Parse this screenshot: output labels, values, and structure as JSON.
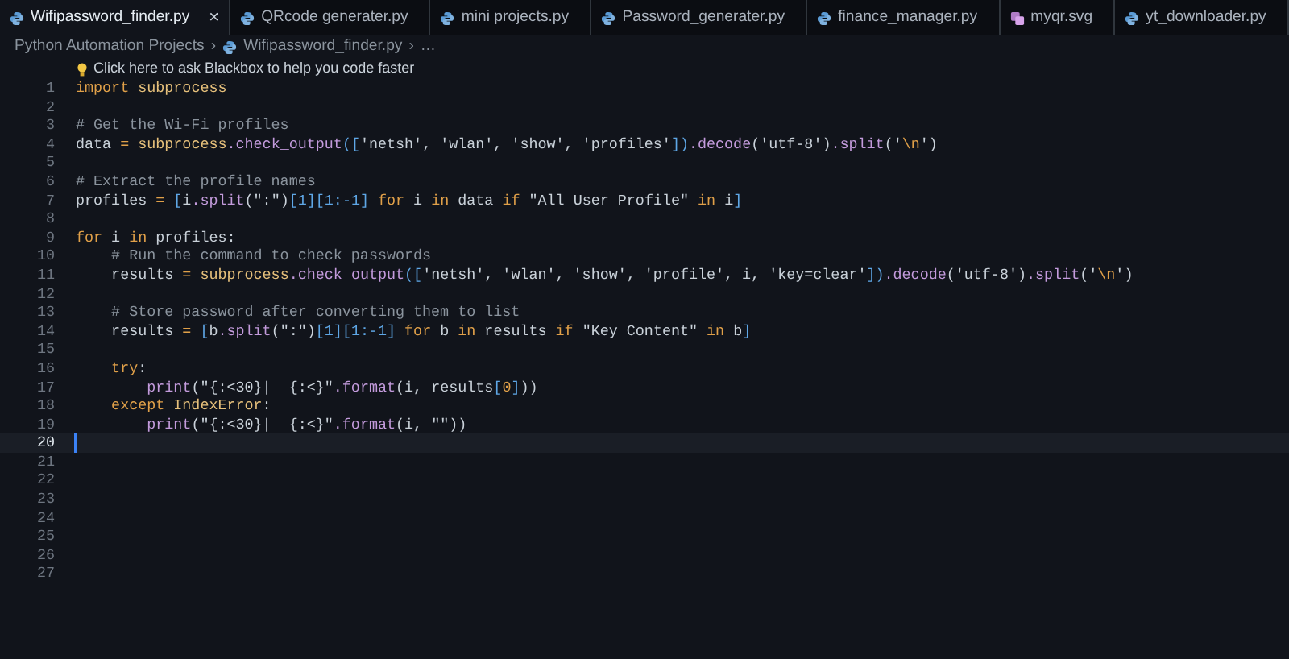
{
  "tabs": [
    {
      "label": "Wifipassword_finder.py",
      "selected": true,
      "close": "×"
    },
    {
      "label": "QRcode generater.py",
      "selected": false
    },
    {
      "label": "mini projects.py",
      "selected": false
    },
    {
      "label": "Password_generater.py",
      "selected": false
    },
    {
      "label": "finance_manager.py",
      "selected": false
    },
    {
      "label": "myqr.svg",
      "selected": false
    },
    {
      "label": "yt_downloader.py",
      "selected": false
    }
  ],
  "breadcrumb": {
    "separator": "›",
    "items": [
      "Python Automation Projects",
      "Wifipassword_finder.py",
      "…"
    ]
  },
  "hint": "Click here to ask Blackbox to help you code faster",
  "lines": [
    {
      "n": "1",
      "current": false,
      "tokens": [
        {
          "kind": "kw",
          "text": "import"
        },
        {
          "kind": "module",
          "text": " subprocess"
        }
      ]
    },
    {
      "n": "2",
      "current": false
    },
    {
      "n": "3",
      "current": false,
      "tokens": [
        {
          "kind": "comment",
          "text": "# Get the Wi-Fi profiles"
        }
      ]
    },
    {
      "n": "4",
      "current": false,
      "tokens": [
        {
          "kind": "plain",
          "text": "data "
        },
        {
          "kind": "op",
          "text": "="
        },
        {
          "kind": "module",
          "text": " subprocess"
        },
        {
          "kind": "fn",
          "text": ".check_output"
        },
        {
          "kind": "punct",
          "text": "(["
        },
        {
          "kind": "str",
          "text": "'netsh', 'wlan', 'show', 'profiles'"
        },
        {
          "kind": "punct",
          "text": "])"
        },
        {
          "kind": "fn",
          "text": ".decode"
        },
        {
          "kind": "plain",
          "text": "("
        },
        {
          "kind": "str",
          "text": "'utf-8'"
        },
        {
          "kind": "plain",
          "text": ")"
        },
        {
          "kind": "fn",
          "text": ".split"
        },
        {
          "kind": "plain",
          "text": "("
        },
        {
          "kind": "str",
          "text": "'"
        },
        {
          "kind": "esc",
          "text": "\\n"
        },
        {
          "kind": "str",
          "text": "'"
        },
        {
          "kind": "plain",
          "text": ")"
        }
      ]
    },
    {
      "n": "5",
      "current": false
    },
    {
      "n": "6",
      "current": false,
      "tokens": [
        {
          "kind": "comment",
          "text": "# Extract the profile names"
        }
      ]
    },
    {
      "n": "7",
      "current": false,
      "tokens": [
        {
          "kind": "plain",
          "text": "profiles "
        },
        {
          "kind": "op",
          "text": "="
        },
        {
          "kind": "punct",
          "text": " ["
        },
        {
          "kind": "plain",
          "text": "i"
        },
        {
          "kind": "fn",
          "text": ".split"
        },
        {
          "kind": "plain",
          "text": "("
        },
        {
          "kind": "str",
          "text": "\":\""
        },
        {
          "kind": "plain",
          "text": ")"
        },
        {
          "kind": "punct",
          "text": "[1][1:-1]"
        },
        {
          "kind": "kw",
          "text": " for"
        },
        {
          "kind": "plain",
          "text": " i "
        },
        {
          "kind": "kw",
          "text": "in"
        },
        {
          "kind": "plain",
          "text": " data "
        },
        {
          "kind": "kw",
          "text": "if"
        },
        {
          "kind": "str",
          "text": " \"All User Profile\""
        },
        {
          "kind": "kw",
          "text": " in"
        },
        {
          "kind": "plain",
          "text": " i"
        },
        {
          "kind": "punct",
          "text": "]"
        }
      ]
    },
    {
      "n": "8",
      "current": false
    },
    {
      "n": "9",
      "current": false,
      "tokens": [
        {
          "kind": "kw",
          "text": "for"
        },
        {
          "kind": "plain",
          "text": " i "
        },
        {
          "kind": "kw",
          "text": "in"
        },
        {
          "kind": "plain",
          "text": " profiles:"
        }
      ]
    },
    {
      "n": "10",
      "current": false,
      "tokens": [
        {
          "kind": "comment",
          "text": "    # Run the command to check passwords"
        }
      ]
    },
    {
      "n": "11",
      "current": false,
      "tokens": [
        {
          "kind": "plain",
          "text": "    results "
        },
        {
          "kind": "op",
          "text": "="
        },
        {
          "kind": "module",
          "text": " subprocess"
        },
        {
          "kind": "fn",
          "text": ".check_output"
        },
        {
          "kind": "punct",
          "text": "(["
        },
        {
          "kind": "str",
          "text": "'netsh', 'wlan', 'show', 'profile', i, 'key=clear'"
        },
        {
          "kind": "punct",
          "text": "])"
        },
        {
          "kind": "fn",
          "text": ".decode"
        },
        {
          "kind": "plain",
          "text": "("
        },
        {
          "kind": "str",
          "text": "'utf-8'"
        },
        {
          "kind": "plain",
          "text": ")"
        },
        {
          "kind": "fn",
          "text": ".split"
        },
        {
          "kind": "plain",
          "text": "("
        },
        {
          "kind": "str",
          "text": "'"
        },
        {
          "kind": "esc",
          "text": "\\n"
        },
        {
          "kind": "str",
          "text": "'"
        },
        {
          "kind": "plain",
          "text": ")"
        }
      ]
    },
    {
      "n": "12",
      "current": false
    },
    {
      "n": "13",
      "current": false,
      "tokens": [
        {
          "kind": "comment",
          "text": "    # Store password after converting them to list"
        }
      ]
    },
    {
      "n": "14",
      "current": false,
      "tokens": [
        {
          "kind": "plain",
          "text": "    results "
        },
        {
          "kind": "op",
          "text": "="
        },
        {
          "kind": "punct",
          "text": " ["
        },
        {
          "kind": "plain",
          "text": "b"
        },
        {
          "kind": "fn",
          "text": ".split"
        },
        {
          "kind": "plain",
          "text": "("
        },
        {
          "kind": "str",
          "text": "\":\""
        },
        {
          "kind": "plain",
          "text": ")"
        },
        {
          "kind": "punct",
          "text": "[1][1:-1]"
        },
        {
          "kind": "kw",
          "text": " for"
        },
        {
          "kind": "plain",
          "text": " b "
        },
        {
          "kind": "kw",
          "text": "in"
        },
        {
          "kind": "plain",
          "text": " results "
        },
        {
          "kind": "kw",
          "text": "if"
        },
        {
          "kind": "str",
          "text": " \"Key Content\""
        },
        {
          "kind": "kw",
          "text": " in"
        },
        {
          "kind": "plain",
          "text": " b"
        },
        {
          "kind": "punct",
          "text": "]"
        }
      ]
    },
    {
      "n": "15",
      "current": false
    },
    {
      "n": "16",
      "current": false,
      "tokens": [
        {
          "kind": "kw",
          "text": "    try"
        },
        {
          "kind": "plain",
          "text": ":"
        }
      ]
    },
    {
      "n": "17",
      "current": false,
      "tokens": [
        {
          "kind": "fn",
          "text": "        print"
        },
        {
          "kind": "plain",
          "text": "("
        },
        {
          "kind": "str",
          "text": "\"{:<30}|  {:<}\""
        },
        {
          "kind": "fn",
          "text": ".format"
        },
        {
          "kind": "plain",
          "text": "(i, results"
        },
        {
          "kind": "punct",
          "text": "["
        },
        {
          "kind": "num",
          "text": "0"
        },
        {
          "kind": "punct",
          "text": "]"
        },
        {
          "kind": "plain",
          "text": "))"
        }
      ]
    },
    {
      "n": "18",
      "current": false,
      "tokens": [
        {
          "kind": "kw",
          "text": "    except"
        },
        {
          "kind": "module",
          "text": " IndexError"
        },
        {
          "kind": "plain",
          "text": ":"
        }
      ]
    },
    {
      "n": "19",
      "current": false,
      "tokens": [
        {
          "kind": "fn",
          "text": "        print"
        },
        {
          "kind": "plain",
          "text": "("
        },
        {
          "kind": "str",
          "text": "\"{:<30}|  {:<}\""
        },
        {
          "kind": "fn",
          "text": ".format"
        },
        {
          "kind": "plain",
          "text": "(i, "
        },
        {
          "kind": "str",
          "text": "\"\""
        },
        {
          "kind": "plain",
          "text": "))"
        }
      ]
    },
    {
      "n": "20",
      "current": true
    },
    {
      "n": "21",
      "current": false
    },
    {
      "n": "22",
      "current": false
    },
    {
      "n": "23",
      "current": false
    },
    {
      "n": "24",
      "current": false
    },
    {
      "n": "25",
      "current": false
    },
    {
      "n": "26",
      "current": false
    },
    {
      "n": "27",
      "current": false
    }
  ]
}
